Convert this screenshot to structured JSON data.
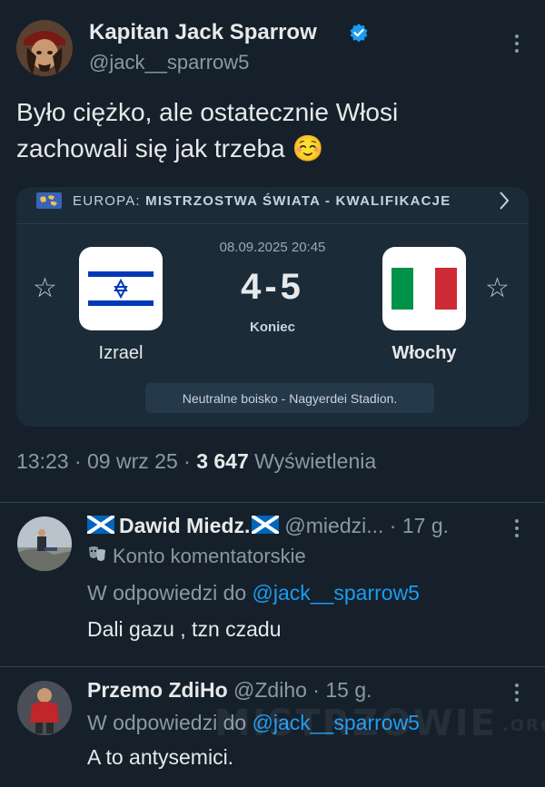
{
  "tweet": {
    "author_name": "Kapitan Jack Sparrow",
    "author_handle": "@jack__sparrow5",
    "text_line1": "Było ciężko, ale ostatecznie Włosi",
    "text_line2": "zachowali się jak trzeba",
    "emoji": "☺️",
    "time": "13:23",
    "date": "09 wrz 25",
    "views_count": "3 647",
    "views_label": "Wyświetlenia",
    "separator": "·"
  },
  "match": {
    "competition_prefix": "EUROPA: ",
    "competition": "MISTRZOSTWA ŚWIATA - KWALIFIKACJE",
    "datetime": "08.09.2025 20:45",
    "score": "4-5",
    "status": "Koniec",
    "home_team": "Izrael",
    "away_team": "Włochy",
    "venue": "Neutralne boisko - Nagyerdei Stadion.",
    "colors": {
      "israel_blue": "#0038b8",
      "italy_green": "#009246",
      "italy_red": "#ce2b37"
    }
  },
  "replies": [
    {
      "name": "Dawid Miedz.",
      "handle": "@miedzi...",
      "age": "17 g.",
      "badge_label": "Konto komentatorskie",
      "reply_to_prefix": "W odpowiedzi do",
      "reply_to_handle": "@jack__sparrow5",
      "text": "Dali gazu , tzn czadu"
    },
    {
      "name": "Przemo ZdiHo",
      "handle": "@Zdiho",
      "age": "15 g.",
      "reply_to_prefix": "W odpowiedzi do",
      "reply_to_handle": "@jack__sparrow5",
      "text": "A to antysemici."
    }
  ],
  "watermark": {
    "text": "MISTRZOWIE",
    "suffix": ".ORG"
  },
  "colors": {
    "background": "#15202b",
    "link": "#1d9bf0",
    "verified": "#1d9bf0"
  }
}
